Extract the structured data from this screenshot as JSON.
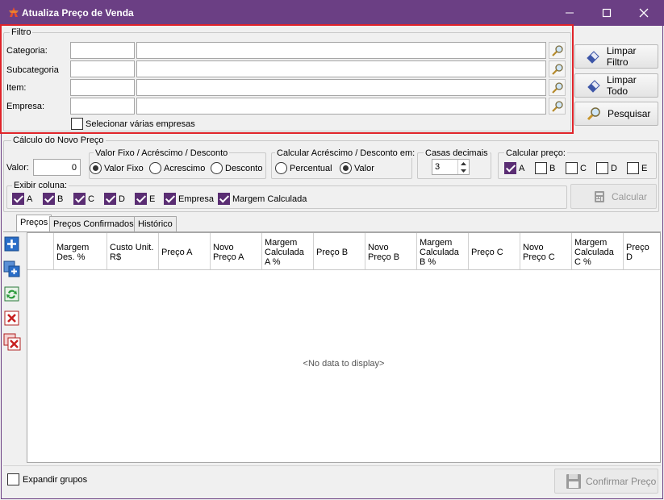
{
  "window": {
    "title": "Atualiza Preço de Venda"
  },
  "filtro": {
    "legend": "Filtro",
    "fields": [
      {
        "label": "Categoria:",
        "code": "",
        "desc": ""
      },
      {
        "label": "Subcategoria",
        "code": "",
        "desc": ""
      },
      {
        "label": "Item:",
        "code": "",
        "desc": ""
      },
      {
        "label": "Empresa:",
        "code": "",
        "desc": ""
      }
    ],
    "multi_empresas": {
      "label": "Selecionar várias empresas",
      "checked": false
    }
  },
  "right_buttons": {
    "limpar_filtro": "Limpar Filtro",
    "limpar_todo": "Limpar Todo",
    "pesquisar": "Pesquisar"
  },
  "calculo": {
    "legend": "Cálculo do Novo Preço",
    "valor_label": "Valor:",
    "valor": "0",
    "tipo": {
      "legend": "Valor Fixo / Acréscimo / Desconto",
      "options": [
        "Valor Fixo",
        "Acrescimo",
        "Desconto"
      ],
      "selected": "Valor Fixo"
    },
    "calc_em": {
      "legend": "Calcular Acréscimo / Desconto em:",
      "options": [
        "Percentual",
        "Valor"
      ],
      "selected": "Valor"
    },
    "casas": {
      "legend": "Casas decimais",
      "value": "3"
    },
    "calc_preco": {
      "legend": "Calcular preço:",
      "options": [
        {
          "label": "A",
          "checked": true
        },
        {
          "label": "B",
          "checked": false
        },
        {
          "label": "C",
          "checked": false
        },
        {
          "label": "D",
          "checked": false
        },
        {
          "label": "E",
          "checked": false
        }
      ]
    },
    "exibir": {
      "legend": "Exibir coluna:",
      "options": [
        {
          "label": "A",
          "checked": true
        },
        {
          "label": "B",
          "checked": true
        },
        {
          "label": "C",
          "checked": true
        },
        {
          "label": "D",
          "checked": true
        },
        {
          "label": "E",
          "checked": true
        },
        {
          "label": "Empresa",
          "checked": true
        },
        {
          "label": "Margem Calculada",
          "checked": true
        }
      ]
    },
    "calcular_button": "Calcular"
  },
  "tabs": [
    {
      "label": "Preços",
      "active": true
    },
    {
      "label": "Preços Confirmados",
      "active": false
    },
    {
      "label": "Histórico",
      "active": false
    }
  ],
  "grid": {
    "columns": [
      "",
      "Margem Des.  %",
      "Custo Unit. R$",
      "Preço A",
      "Novo Preço A",
      "Margem Calculada A %",
      "Preço B",
      "Novo Preço B",
      "Margem Calculada B %",
      "Preço C",
      "Novo Preço C",
      "Margem Calculada C %",
      "Preço D"
    ],
    "empty_text": "<No data to display>"
  },
  "toolbar_icons": [
    "add-icon",
    "add-multiple-icon",
    "refresh-icon",
    "delete-icon",
    "delete-all-icon"
  ],
  "footer": {
    "expandir_label": "Expandir grupos",
    "expandir_checked": false,
    "confirmar_button": "Confirmar Preço"
  },
  "colors": {
    "titlebar": "#6b3f84",
    "check": "#5a2d73",
    "highlight": "#e0242a"
  }
}
